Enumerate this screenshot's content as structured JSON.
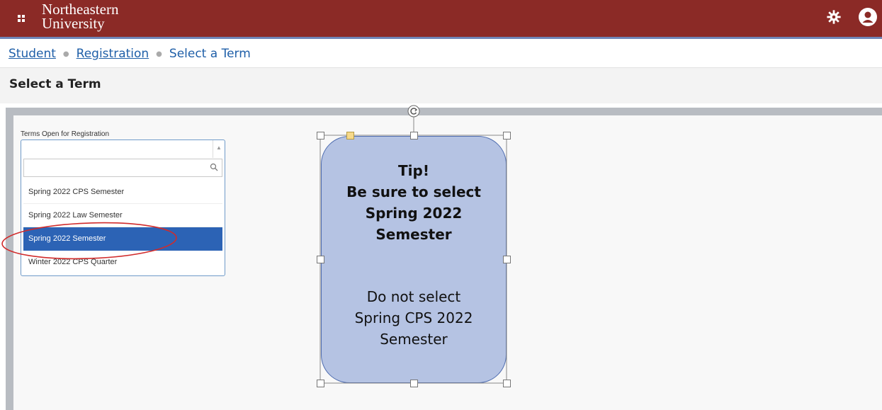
{
  "header": {
    "logo_line1": "Northeastern",
    "logo_line2": "University",
    "brand_color": "#8b2a26",
    "icons": [
      "apps-grid-icon",
      "gear-icon",
      "user-avatar-icon"
    ]
  },
  "breadcrumb": {
    "items": [
      "Student",
      "Registration",
      "Select a Term"
    ]
  },
  "page_title": "Select a Term",
  "terms": {
    "label": "Terms Open for Registration",
    "search_placeholder": "",
    "options": [
      "Spring 2022 CPS Semester",
      "Spring 2022 Law Semester",
      "Spring 2022 Semester",
      "Winter 2022 CPS Quarter"
    ],
    "selected_index": 2,
    "selected_color": "#2c63b5"
  },
  "tip": {
    "bold_lines": [
      "Tip!",
      "Be sure to select",
      "Spring 2022",
      "Semester"
    ],
    "normal_lines": [
      "Do not select",
      "Spring CPS 2022",
      "Semester"
    ],
    "fill_color": "#b5c3e3"
  }
}
